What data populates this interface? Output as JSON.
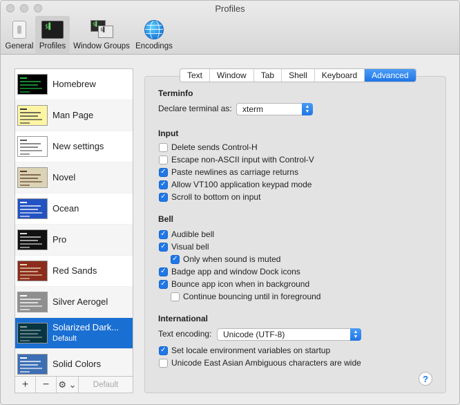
{
  "window": {
    "title": "Profiles"
  },
  "toolbar": {
    "items": [
      {
        "label": "General",
        "icon": "switch-icon"
      },
      {
        "label": "Profiles",
        "icon": "terminal-icon",
        "selected": true
      },
      {
        "label": "Window Groups",
        "icon": "window-groups-icon"
      },
      {
        "label": "Encodings",
        "icon": "globe-icon"
      }
    ]
  },
  "profiles": [
    {
      "name": "Homebrew",
      "bg": "#000000",
      "fg": "#22c24a"
    },
    {
      "name": "Man Page",
      "bg": "#fef5a4",
      "fg": "#333333"
    },
    {
      "name": "New settings",
      "bg": "#ffffff",
      "fg": "#555555"
    },
    {
      "name": "Novel",
      "bg": "#dcd3b6",
      "fg": "#5a3d22"
    },
    {
      "name": "Ocean",
      "bg": "#2352c2",
      "fg": "#ffffff"
    },
    {
      "name": "Pro",
      "bg": "#111111",
      "fg": "#dddddd"
    },
    {
      "name": "Red Sands",
      "bg": "#8c2c1c",
      "fg": "#e8d8b8"
    },
    {
      "name": "Silver Aerogel",
      "bg": "#8f8f8f",
      "fg": "#ffffff"
    },
    {
      "name": "Solarized Dark...",
      "subtitle": "Default",
      "bg": "#073642",
      "fg": "#93a1a1",
      "selected": true
    },
    {
      "name": "Solid Colors",
      "bg": "#3d6fb5",
      "fg": "#ffffff"
    }
  ],
  "list_buttons": {
    "add": "+",
    "remove": "−",
    "gear": "⚙︎ ⌄",
    "default": "Default"
  },
  "tabs": [
    {
      "label": "Text"
    },
    {
      "label": "Window"
    },
    {
      "label": "Tab"
    },
    {
      "label": "Shell"
    },
    {
      "label": "Keyboard"
    },
    {
      "label": "Advanced",
      "active": true
    }
  ],
  "terminfo": {
    "heading": "Terminfo",
    "declare_label": "Declare terminal as:",
    "declare_value": "xterm"
  },
  "input": {
    "heading": "Input",
    "options": [
      {
        "label": "Delete sends Control-H",
        "checked": false
      },
      {
        "label": "Escape non-ASCII input with Control-V",
        "checked": false
      },
      {
        "label": "Paste newlines as carriage returns",
        "checked": true
      },
      {
        "label": "Allow VT100 application keypad mode",
        "checked": true
      },
      {
        "label": "Scroll to bottom on input",
        "checked": true
      }
    ]
  },
  "bell": {
    "heading": "Bell",
    "options": [
      {
        "label": "Audible bell",
        "checked": true
      },
      {
        "label": "Visual bell",
        "checked": true
      },
      {
        "label": "Only when sound is muted",
        "checked": true
      },
      {
        "label": "Badge app and window Dock icons",
        "checked": true
      },
      {
        "label": "Bounce app icon when in background",
        "checked": true
      },
      {
        "label": "Continue bouncing until in foreground",
        "checked": false
      }
    ]
  },
  "international": {
    "heading": "International",
    "encoding_label": "Text encoding:",
    "encoding_value": "Unicode (UTF-8)",
    "options": [
      {
        "label": "Set locale environment variables on startup",
        "checked": true
      },
      {
        "label": "Unicode East Asian Ambiguous characters are wide",
        "checked": false
      }
    ]
  },
  "help_label": "?",
  "colors": {
    "accent": "#1f78e8",
    "selection": "#1a6fd2"
  }
}
